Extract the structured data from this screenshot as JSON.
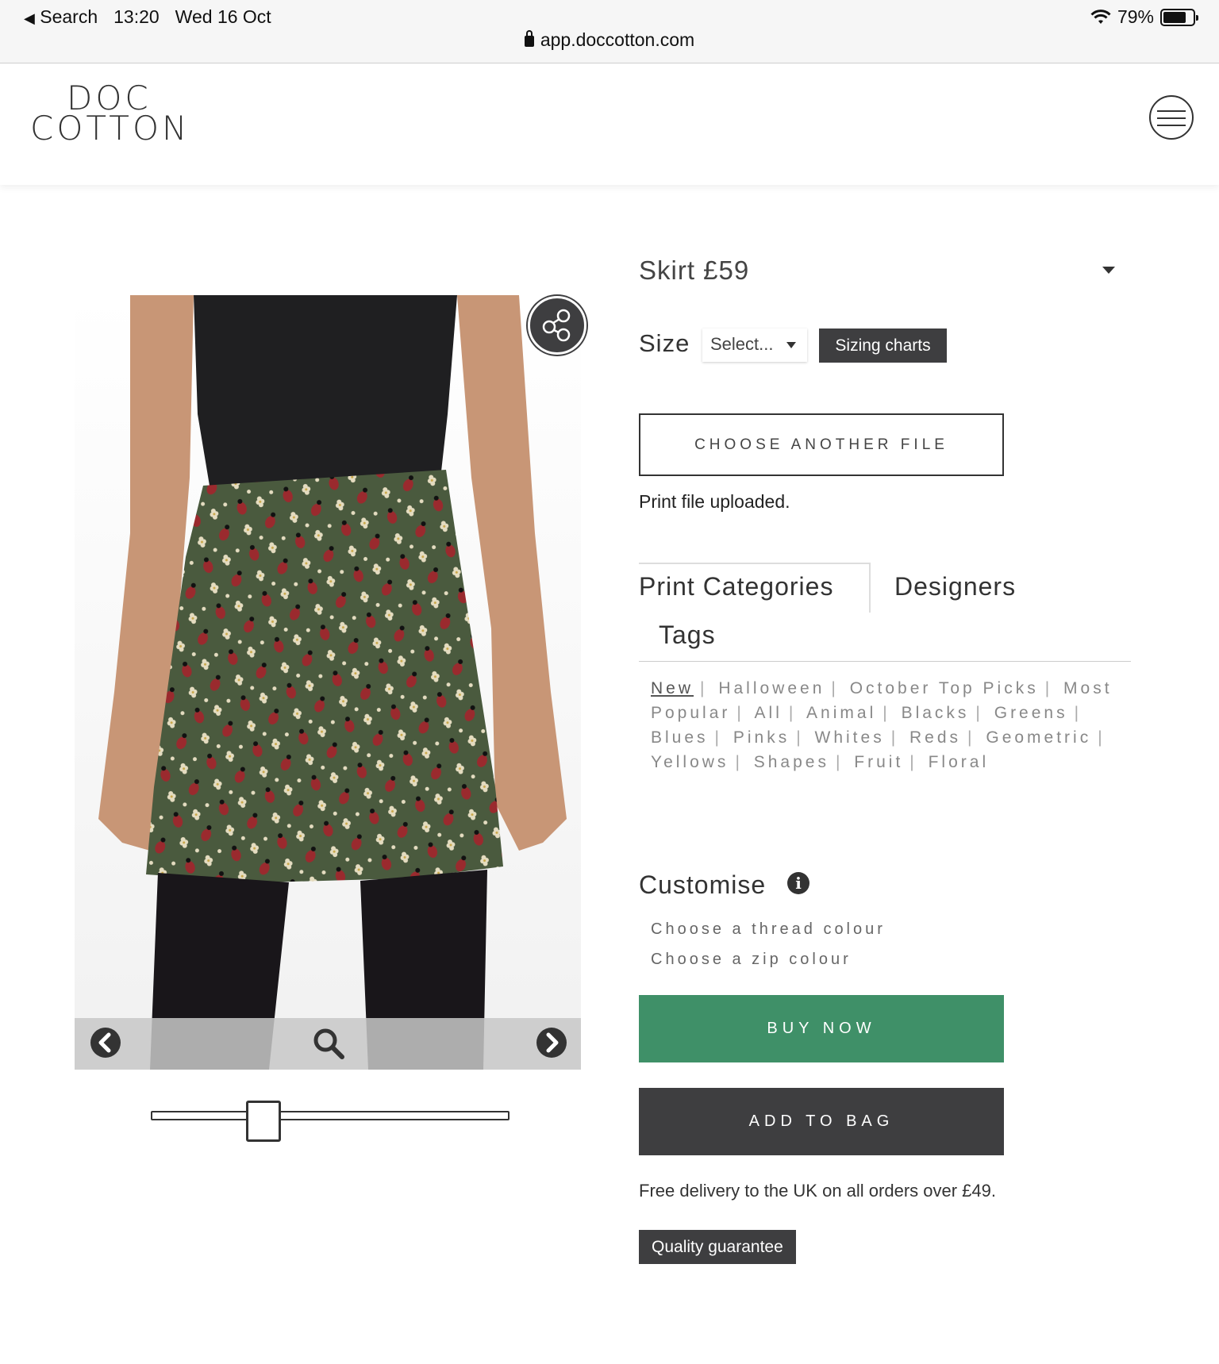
{
  "status_bar": {
    "back_label": "Search",
    "time": "13:20",
    "date": "Wed 16 Oct",
    "url": "app.doccotton.com",
    "battery": "79%",
    "battery_level": 0.79
  },
  "header": {
    "logo_line1": "DOC",
    "logo_line2": "COTTON"
  },
  "product": {
    "name_price": "Skirt £59",
    "size_label": "Size",
    "size_select": "Select...",
    "sizing_charts": "Sizing charts",
    "choose_file": "CHOOSE ANOTHER FILE",
    "upload_status": "Print file uploaded."
  },
  "tabs": [
    {
      "label": "Print Categories"
    },
    {
      "label": "Designers"
    },
    {
      "label": "Tags"
    }
  ],
  "categories": [
    "New",
    "Halloween",
    "October Top Picks",
    "Most Popular",
    "All",
    "Animal",
    "Blacks",
    "Greens",
    "Blues",
    "Pinks",
    "Whites",
    "Reds",
    "Geometric",
    "Yellows",
    "Shapes",
    "Fruit",
    "Floral"
  ],
  "customise": {
    "title": "Customise",
    "thread": "Choose a thread colour",
    "zip": "Choose a zip colour"
  },
  "actions": {
    "buy_now": "BUY NOW",
    "add_to_bag": "ADD TO BAG",
    "delivery_note": "Free delivery to the UK on all orders over £49.",
    "quality": "Quality guarantee"
  },
  "colors": {
    "buy_green": "#3f9068",
    "dark_button": "#3e3e40",
    "skirt_green": "#4a5a3e",
    "ladybird_red": "#9a2a2e"
  },
  "image_zoom_level": 0.3
}
